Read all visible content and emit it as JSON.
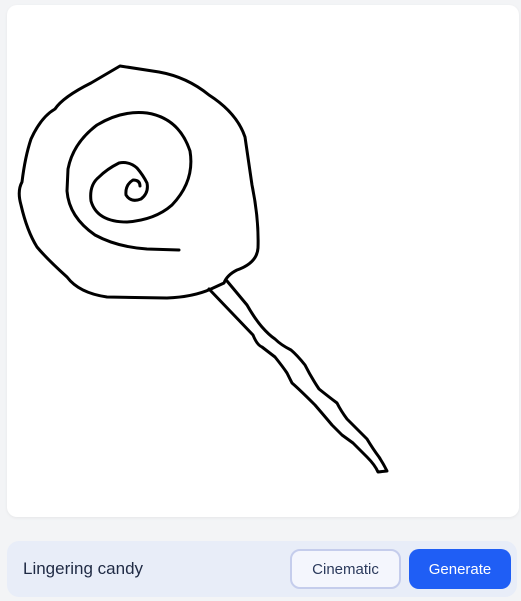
{
  "prompt": {
    "value": "Lingering candy"
  },
  "buttons": {
    "style_label": "Cinematic",
    "generate_label": "Generate"
  },
  "colors": {
    "page_background": "#f3f4f6",
    "canvas_background": "#ffffff",
    "stroke": "#000000",
    "prompt_bar": "#e8edf8",
    "accent": "#1f5ef5",
    "style_button_border": "#c5cdec"
  }
}
